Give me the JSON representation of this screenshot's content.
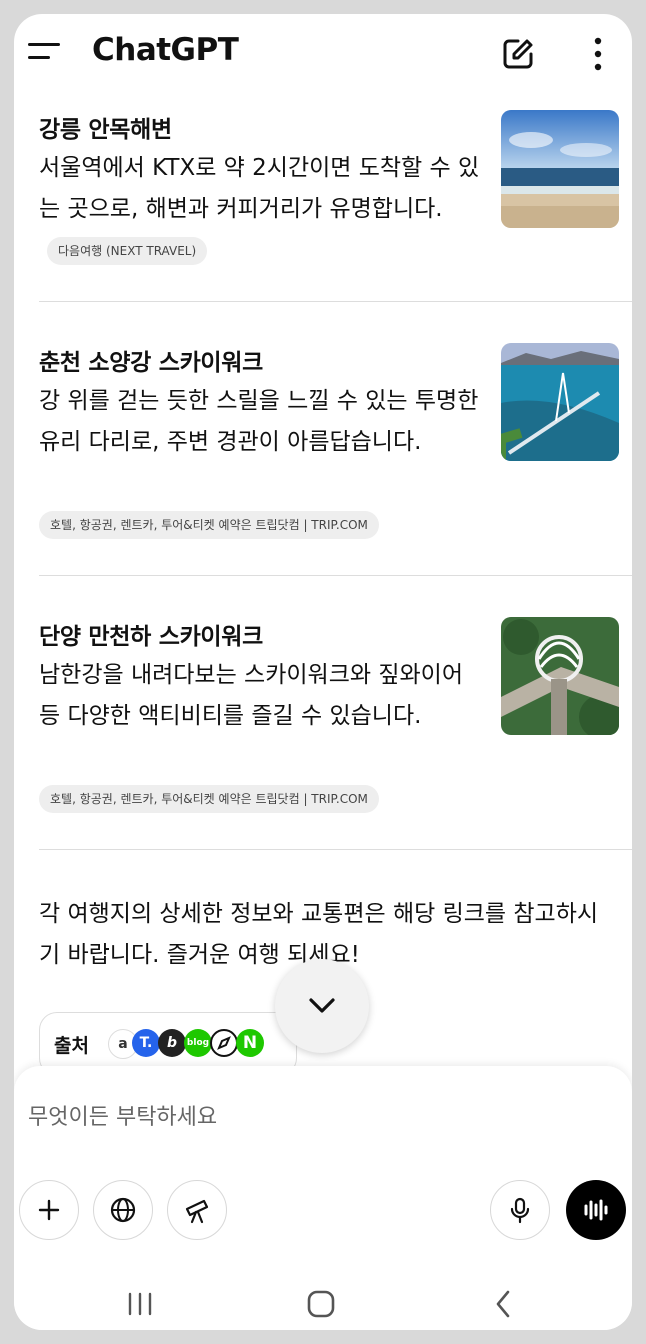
{
  "header": {
    "title": "ChatGPT"
  },
  "items": [
    {
      "title": "강릉 안목해변",
      "description": "서울역에서 KTX로 약 2시간이면 도착할 수 있는 곳으로, 해변과 커피거리가 유명합니다.",
      "source_badge": "다음여행 (NEXT TRAVEL)"
    },
    {
      "title": "춘천 소양강 스카이워크",
      "description": "강 위를 걷는 듯한 스릴을 느낄 수 있는 투명한 유리 다리로, 주변 경관이 아름답습니다.",
      "source_badge": "호텔, 항공권, 렌트카, 투어&티켓 예약은 트립닷컴 | TRIP.COM"
    },
    {
      "title": "단양 만천하 스카이워크",
      "description": "남한강을 내려다보는 스카이워크와 짚와이어 등 다양한 액티비티를 즐길 수 있습니다.",
      "source_badge": "호텔, 항공권, 렌트카, 투어&티켓 예약은 트립닷컴 | TRIP.COM"
    }
  ],
  "closing": "각 여행지의 상세한 정보와 교통편은 해당 링크를 참고하시기 바랍니다. 즐거운 여행 되세요!",
  "sources": {
    "label": "출처",
    "icons": [
      {
        "name": "daum-source-icon",
        "glyph": "a",
        "color": "#ffffff"
      },
      {
        "name": "trip-source-icon",
        "glyph": "T.",
        "color": "#2563eb"
      },
      {
        "name": "brunch-source-icon",
        "glyph": "b",
        "color": "#222222"
      },
      {
        "name": "blog-source-icon",
        "glyph": "blog",
        "color": "#1ec800"
      },
      {
        "name": "compass-source-icon",
        "glyph": "",
        "color": "#ffffff"
      },
      {
        "name": "naver-source-icon",
        "glyph": "N",
        "color": "#1ec800"
      }
    ]
  },
  "composer": {
    "placeholder": "무엇이든 부탁하세요"
  },
  "colors": {
    "background": "#d9d9d9",
    "surface": "#ffffff",
    "badge": "#eeeeee",
    "voice_button": "#000000"
  }
}
